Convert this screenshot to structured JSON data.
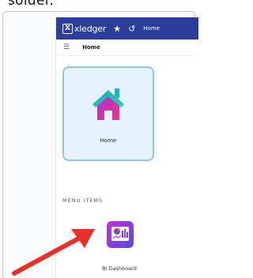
{
  "caption_fragment": "solder.",
  "app": {
    "logo_mark": "X",
    "logo_text": "xledger",
    "star_icon": "star-icon",
    "history_icon": "history-icon",
    "home_nav_label": "Home"
  },
  "breadcrumb": {
    "label": "Home"
  },
  "home_tile": {
    "label": "Home"
  },
  "menu": {
    "heading": "MENU ITEMS",
    "items": [
      {
        "label": "BI Dashboard",
        "icon": "bi-dashboard-icon"
      }
    ]
  },
  "colors": {
    "topbar": "#2d3e9a",
    "tile_border": "#8fc4ee",
    "tile_bg": "#e7f3fc",
    "arrow": "#e8302a"
  }
}
